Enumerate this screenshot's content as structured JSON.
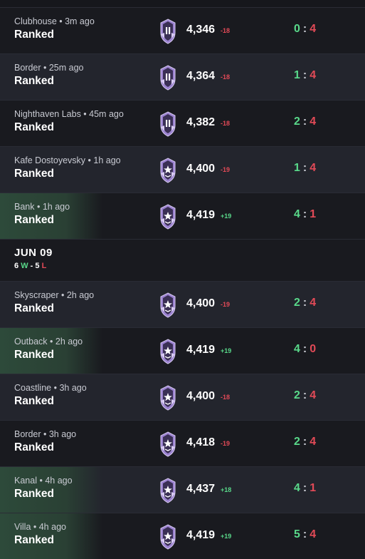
{
  "colors": {
    "win": "#59d98a",
    "loss": "#e24a57",
    "rank_icon": "#9b82d0"
  },
  "matches_before": [
    {
      "map": "Clubhouse",
      "time": "3m ago",
      "mode": "Ranked",
      "rank_icon": "rank-silver-2-icon",
      "rating": "4,346",
      "delta": "-18",
      "delta_sign": "neg",
      "score_ours": "0",
      "score_theirs": "4",
      "result": "loss"
    },
    {
      "map": "Border",
      "time": "25m ago",
      "mode": "Ranked",
      "rank_icon": "rank-silver-2-icon",
      "rating": "4,364",
      "delta": "-18",
      "delta_sign": "neg",
      "score_ours": "1",
      "score_theirs": "4",
      "result": "loss"
    },
    {
      "map": "Nighthaven Labs",
      "time": "45m ago",
      "mode": "Ranked",
      "rank_icon": "rank-silver-2-icon",
      "rating": "4,382",
      "delta": "-18",
      "delta_sign": "neg",
      "score_ours": "2",
      "score_theirs": "4",
      "result": "loss"
    },
    {
      "map": "Kafe Dostoyevsky",
      "time": "1h ago",
      "mode": "Ranked",
      "rank_icon": "rank-silver-1-icon",
      "rating": "4,400",
      "delta": "-19",
      "delta_sign": "neg",
      "score_ours": "1",
      "score_theirs": "4",
      "result": "loss"
    },
    {
      "map": "Bank",
      "time": "1h ago",
      "mode": "Ranked",
      "rank_icon": "rank-silver-1-icon",
      "rating": "4,419",
      "delta": "+19",
      "delta_sign": "pos",
      "score_ours": "4",
      "score_theirs": "1",
      "result": "win"
    }
  ],
  "day_header": {
    "date": "JUN 09",
    "wins": "6",
    "w_label": "W",
    "dash": "-",
    "losses": "5",
    "l_label": "L"
  },
  "matches_after": [
    {
      "map": "Skyscraper",
      "time": "2h ago",
      "mode": "Ranked",
      "rank_icon": "rank-silver-1-icon",
      "rating": "4,400",
      "delta": "-19",
      "delta_sign": "neg",
      "score_ours": "2",
      "score_theirs": "4",
      "result": "loss"
    },
    {
      "map": "Outback",
      "time": "2h ago",
      "mode": "Ranked",
      "rank_icon": "rank-silver-1-icon",
      "rating": "4,419",
      "delta": "+19",
      "delta_sign": "pos",
      "score_ours": "4",
      "score_theirs": "0",
      "result": "win"
    },
    {
      "map": "Coastline",
      "time": "3h ago",
      "mode": "Ranked",
      "rank_icon": "rank-silver-1-icon",
      "rating": "4,400",
      "delta": "-18",
      "delta_sign": "neg",
      "score_ours": "2",
      "score_theirs": "4",
      "result": "loss"
    },
    {
      "map": "Border",
      "time": "3h ago",
      "mode": "Ranked",
      "rank_icon": "rank-silver-1-icon",
      "rating": "4,418",
      "delta": "-19",
      "delta_sign": "neg",
      "score_ours": "2",
      "score_theirs": "4",
      "result": "loss"
    },
    {
      "map": "Kanal",
      "time": "4h ago",
      "mode": "Ranked",
      "rank_icon": "rank-silver-1-icon",
      "rating": "4,437",
      "delta": "+18",
      "delta_sign": "pos",
      "score_ours": "4",
      "score_theirs": "1",
      "result": "win"
    },
    {
      "map": "Villa",
      "time": "4h ago",
      "mode": "Ranked",
      "rank_icon": "rank-silver-1-icon",
      "rating": "4,419",
      "delta": "+19",
      "delta_sign": "pos",
      "score_ours": "5",
      "score_theirs": "4",
      "result": "win"
    }
  ]
}
